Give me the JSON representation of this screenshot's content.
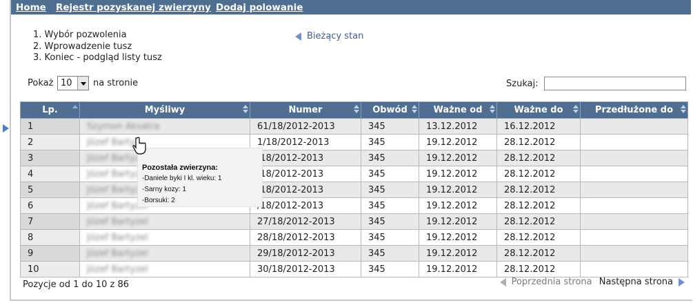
{
  "nav": {
    "home": "Home",
    "registry": "Rejestr pozyskanej zwierzyny",
    "add_hunt": "Dodaj polowanie"
  },
  "steps": [
    "1.  Wybór pozwolenia",
    "2.  Wprowadzenie tusz",
    "3.  Koniec - podgląd listy tusz"
  ],
  "current_state_link": "Bieżący stan",
  "length": {
    "prefix": "Pokaż",
    "value": "10",
    "suffix": "na stronie"
  },
  "search": {
    "label": "Szukaj:",
    "value": ""
  },
  "table": {
    "headers": [
      "Lp.",
      "Myśliwy",
      "Numer",
      "Obwód",
      "Ważne od",
      "Ważne do",
      "Przedłużone do"
    ],
    "rows": [
      [
        "1",
        "Szymon Aksatra",
        "61/18/2012-2013",
        "345",
        "13.12.2012",
        "16.12.2012",
        ""
      ],
      [
        "2",
        "Józef Barty",
        "1/18/2012-2013",
        "345",
        "19.12.2012",
        "28.12.2012",
        ""
      ],
      [
        "3",
        "Józef Bartyzel",
        "/18/2012-2013",
        "345",
        "19.12.2012",
        "28.12.2012",
        ""
      ],
      [
        "4",
        "Józef Bartyzel",
        "/18/2012-2013",
        "345",
        "19.12.2012",
        "28.12.2012",
        ""
      ],
      [
        "5",
        "Józef Bartyzel",
        "/18/2012-2013",
        "345",
        "19.12.2012",
        "28.12.2012",
        ""
      ],
      [
        "6",
        "Józef Bartyzel",
        "/18/2012-2013",
        "345",
        "19.12.2012",
        "28.12.2012",
        ""
      ],
      [
        "7",
        "Józef Bartyzel",
        "27/18/2012-2013",
        "345",
        "19.12.2012",
        "28.12.2012",
        ""
      ],
      [
        "8",
        "Józef Bartyzel",
        "28/18/2012-2013",
        "345",
        "19.12.2012",
        "28.12.2012",
        ""
      ],
      [
        "9",
        "Józef Bartyzel",
        "29/18/2012-2013",
        "345",
        "19.12.2012",
        "28.12.2012",
        ""
      ],
      [
        "10",
        "Józef Bartyzel",
        "30/18/2012-2013",
        "345",
        "19.12.2012",
        "28.12.2012",
        ""
      ]
    ]
  },
  "tooltip": {
    "title": "Pozostała zwierzyna:",
    "lines": [
      "-Daniele byki I kl. wieku: 1",
      "-Sarny kozy: 1",
      "-Borsuki: 2"
    ]
  },
  "info": "Pozycje od 1 do 10 z 86",
  "pager": {
    "prev": "Poprzednia strona",
    "next": "Następna strona"
  },
  "colors": {
    "header_bg": "#4f6e92",
    "link_blue": "#3d5f9e",
    "arrow_blue": "#6f8fcf"
  }
}
